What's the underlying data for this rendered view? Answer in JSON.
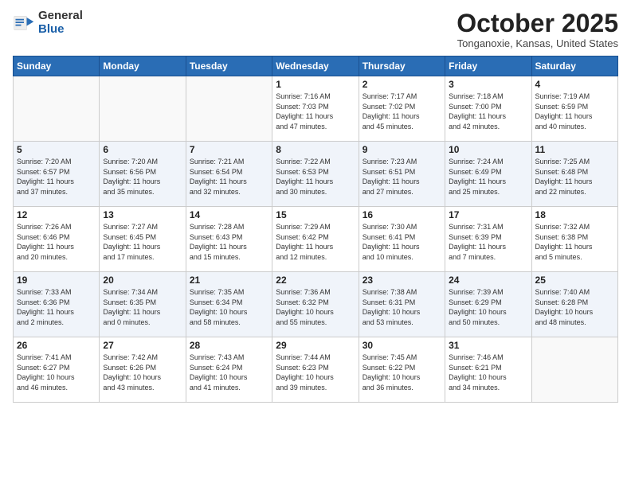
{
  "header": {
    "logo_general": "General",
    "logo_blue": "Blue",
    "month_title": "October 2025",
    "location": "Tonganoxie, Kansas, United States"
  },
  "days_of_week": [
    "Sunday",
    "Monday",
    "Tuesday",
    "Wednesday",
    "Thursday",
    "Friday",
    "Saturday"
  ],
  "weeks": [
    [
      {
        "day": "",
        "info": ""
      },
      {
        "day": "",
        "info": ""
      },
      {
        "day": "",
        "info": ""
      },
      {
        "day": "1",
        "info": "Sunrise: 7:16 AM\nSunset: 7:03 PM\nDaylight: 11 hours\nand 47 minutes."
      },
      {
        "day": "2",
        "info": "Sunrise: 7:17 AM\nSunset: 7:02 PM\nDaylight: 11 hours\nand 45 minutes."
      },
      {
        "day": "3",
        "info": "Sunrise: 7:18 AM\nSunset: 7:00 PM\nDaylight: 11 hours\nand 42 minutes."
      },
      {
        "day": "4",
        "info": "Sunrise: 7:19 AM\nSunset: 6:59 PM\nDaylight: 11 hours\nand 40 minutes."
      }
    ],
    [
      {
        "day": "5",
        "info": "Sunrise: 7:20 AM\nSunset: 6:57 PM\nDaylight: 11 hours\nand 37 minutes."
      },
      {
        "day": "6",
        "info": "Sunrise: 7:20 AM\nSunset: 6:56 PM\nDaylight: 11 hours\nand 35 minutes."
      },
      {
        "day": "7",
        "info": "Sunrise: 7:21 AM\nSunset: 6:54 PM\nDaylight: 11 hours\nand 32 minutes."
      },
      {
        "day": "8",
        "info": "Sunrise: 7:22 AM\nSunset: 6:53 PM\nDaylight: 11 hours\nand 30 minutes."
      },
      {
        "day": "9",
        "info": "Sunrise: 7:23 AM\nSunset: 6:51 PM\nDaylight: 11 hours\nand 27 minutes."
      },
      {
        "day": "10",
        "info": "Sunrise: 7:24 AM\nSunset: 6:49 PM\nDaylight: 11 hours\nand 25 minutes."
      },
      {
        "day": "11",
        "info": "Sunrise: 7:25 AM\nSunset: 6:48 PM\nDaylight: 11 hours\nand 22 minutes."
      }
    ],
    [
      {
        "day": "12",
        "info": "Sunrise: 7:26 AM\nSunset: 6:46 PM\nDaylight: 11 hours\nand 20 minutes."
      },
      {
        "day": "13",
        "info": "Sunrise: 7:27 AM\nSunset: 6:45 PM\nDaylight: 11 hours\nand 17 minutes."
      },
      {
        "day": "14",
        "info": "Sunrise: 7:28 AM\nSunset: 6:43 PM\nDaylight: 11 hours\nand 15 minutes."
      },
      {
        "day": "15",
        "info": "Sunrise: 7:29 AM\nSunset: 6:42 PM\nDaylight: 11 hours\nand 12 minutes."
      },
      {
        "day": "16",
        "info": "Sunrise: 7:30 AM\nSunset: 6:41 PM\nDaylight: 11 hours\nand 10 minutes."
      },
      {
        "day": "17",
        "info": "Sunrise: 7:31 AM\nSunset: 6:39 PM\nDaylight: 11 hours\nand 7 minutes."
      },
      {
        "day": "18",
        "info": "Sunrise: 7:32 AM\nSunset: 6:38 PM\nDaylight: 11 hours\nand 5 minutes."
      }
    ],
    [
      {
        "day": "19",
        "info": "Sunrise: 7:33 AM\nSunset: 6:36 PM\nDaylight: 11 hours\nand 2 minutes."
      },
      {
        "day": "20",
        "info": "Sunrise: 7:34 AM\nSunset: 6:35 PM\nDaylight: 11 hours\nand 0 minutes."
      },
      {
        "day": "21",
        "info": "Sunrise: 7:35 AM\nSunset: 6:34 PM\nDaylight: 10 hours\nand 58 minutes."
      },
      {
        "day": "22",
        "info": "Sunrise: 7:36 AM\nSunset: 6:32 PM\nDaylight: 10 hours\nand 55 minutes."
      },
      {
        "day": "23",
        "info": "Sunrise: 7:38 AM\nSunset: 6:31 PM\nDaylight: 10 hours\nand 53 minutes."
      },
      {
        "day": "24",
        "info": "Sunrise: 7:39 AM\nSunset: 6:29 PM\nDaylight: 10 hours\nand 50 minutes."
      },
      {
        "day": "25",
        "info": "Sunrise: 7:40 AM\nSunset: 6:28 PM\nDaylight: 10 hours\nand 48 minutes."
      }
    ],
    [
      {
        "day": "26",
        "info": "Sunrise: 7:41 AM\nSunset: 6:27 PM\nDaylight: 10 hours\nand 46 minutes."
      },
      {
        "day": "27",
        "info": "Sunrise: 7:42 AM\nSunset: 6:26 PM\nDaylight: 10 hours\nand 43 minutes."
      },
      {
        "day": "28",
        "info": "Sunrise: 7:43 AM\nSunset: 6:24 PM\nDaylight: 10 hours\nand 41 minutes."
      },
      {
        "day": "29",
        "info": "Sunrise: 7:44 AM\nSunset: 6:23 PM\nDaylight: 10 hours\nand 39 minutes."
      },
      {
        "day": "30",
        "info": "Sunrise: 7:45 AM\nSunset: 6:22 PM\nDaylight: 10 hours\nand 36 minutes."
      },
      {
        "day": "31",
        "info": "Sunrise: 7:46 AM\nSunset: 6:21 PM\nDaylight: 10 hours\nand 34 minutes."
      },
      {
        "day": "",
        "info": ""
      }
    ]
  ]
}
